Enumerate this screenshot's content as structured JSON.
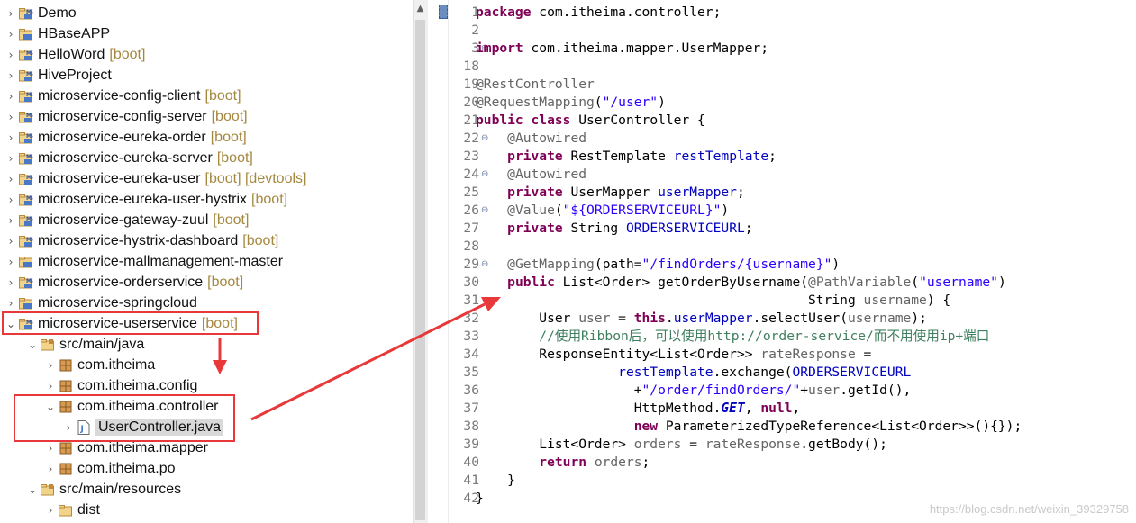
{
  "explorer": {
    "items": [
      {
        "twisty": "›",
        "icon": "maven-project-icon",
        "label": "Demo",
        "decoration": ""
      },
      {
        "twisty": "›",
        "icon": "project-folder-icon",
        "label": "HBaseAPP",
        "decoration": ""
      },
      {
        "twisty": "›",
        "icon": "maven-project-icon",
        "label": "HelloWord",
        "decoration": "[boot]"
      },
      {
        "twisty": "›",
        "icon": "maven-project-icon",
        "label": "HiveProject",
        "decoration": ""
      },
      {
        "twisty": "›",
        "icon": "maven-project-icon",
        "label": "microservice-config-client",
        "decoration": "[boot]"
      },
      {
        "twisty": "›",
        "icon": "maven-project-icon",
        "label": "microservice-config-server",
        "decoration": "[boot]"
      },
      {
        "twisty": "›",
        "icon": "maven-project-icon",
        "label": "microservice-eureka-order",
        "decoration": "[boot]"
      },
      {
        "twisty": "›",
        "icon": "maven-project-icon",
        "label": "microservice-eureka-server",
        "decoration": "[boot]"
      },
      {
        "twisty": "›",
        "icon": "maven-project-icon",
        "label": "microservice-eureka-user",
        "decoration": "[boot] [devtools]"
      },
      {
        "twisty": "›",
        "icon": "maven-project-icon",
        "label": "microservice-eureka-user-hystrix",
        "decoration": "[boot]"
      },
      {
        "twisty": "›",
        "icon": "maven-project-icon",
        "label": "microservice-gateway-zuul",
        "decoration": "[boot]"
      },
      {
        "twisty": "›",
        "icon": "maven-project-icon",
        "label": "microservice-hystrix-dashboard",
        "decoration": "[boot]"
      },
      {
        "twisty": "›",
        "icon": "project-folder-icon",
        "label": "microservice-mallmanagement-master",
        "decoration": ""
      },
      {
        "twisty": "›",
        "icon": "maven-project-icon",
        "label": "microservice-orderservice",
        "decoration": "[boot]"
      },
      {
        "twisty": "›",
        "icon": "project-folder-icon",
        "label": "microservice-springcloud",
        "decoration": ""
      },
      {
        "twisty": "⌄",
        "icon": "maven-project-icon",
        "label": "microservice-userservice",
        "decoration": "[boot]"
      },
      {
        "twisty": "⌄",
        "icon": "source-folder-icon",
        "label": "src/main/java",
        "decoration": ""
      },
      {
        "twisty": "›",
        "icon": "package-icon",
        "label": "com.itheima",
        "decoration": ""
      },
      {
        "twisty": "›",
        "icon": "package-icon",
        "label": "com.itheima.config",
        "decoration": ""
      },
      {
        "twisty": "⌄",
        "icon": "package-icon",
        "label": "com.itheima.controller",
        "decoration": ""
      },
      {
        "twisty": "›",
        "icon": "java-file-icon",
        "label": "UserController.java",
        "decoration": ""
      },
      {
        "twisty": "›",
        "icon": "package-icon",
        "label": "com.itheima.mapper",
        "decoration": ""
      },
      {
        "twisty": "›",
        "icon": "package-icon",
        "label": "com.itheima.po",
        "decoration": ""
      },
      {
        "twisty": "⌄",
        "icon": "source-folder-icon",
        "label": "src/main/resources",
        "decoration": ""
      },
      {
        "twisty": "›",
        "icon": "folder-icon",
        "label": "dist",
        "decoration": ""
      }
    ]
  },
  "editor": {
    "lines": [
      {
        "n": "1",
        "fold": "",
        "tokens": [
          [
            "kw",
            "package"
          ],
          [
            "tx",
            " com.itheima.controller;"
          ]
        ]
      },
      {
        "n": "2",
        "fold": "",
        "tokens": []
      },
      {
        "n": "3",
        "fold": "⊕",
        "tokens": [
          [
            "kw",
            "import"
          ],
          [
            "tx",
            " com.itheima.mapper.UserMapper;"
          ]
        ]
      },
      {
        "n": "18",
        "fold": "",
        "tokens": []
      },
      {
        "n": "19",
        "fold": "",
        "tokens": [
          [
            "an",
            "@RestController"
          ]
        ]
      },
      {
        "n": "20",
        "fold": "",
        "tokens": [
          [
            "an",
            "@RequestMapping"
          ],
          [
            "tx",
            "("
          ],
          [
            "str",
            "\"/user\""
          ],
          [
            "tx",
            ")"
          ]
        ]
      },
      {
        "n": "21",
        "fold": "",
        "tokens": [
          [
            "kw",
            "public"
          ],
          [
            "tx",
            " "
          ],
          [
            "kw",
            "class"
          ],
          [
            "tx",
            " UserController {"
          ]
        ]
      },
      {
        "n": "22",
        "fold": "⊖",
        "tokens": [
          [
            "tx",
            "    "
          ],
          [
            "an",
            "@Autowired"
          ]
        ]
      },
      {
        "n": "23",
        "fold": "",
        "tokens": [
          [
            "tx",
            "    "
          ],
          [
            "kw",
            "private"
          ],
          [
            "tx",
            " RestTemplate "
          ],
          [
            "fld",
            "restTemplate"
          ],
          [
            "tx",
            ";"
          ]
        ]
      },
      {
        "n": "24",
        "fold": "⊖",
        "tokens": [
          [
            "tx",
            "    "
          ],
          [
            "an",
            "@Autowired"
          ]
        ]
      },
      {
        "n": "25",
        "fold": "",
        "tokens": [
          [
            "tx",
            "    "
          ],
          [
            "kw",
            "private"
          ],
          [
            "tx",
            " UserMapper "
          ],
          [
            "fld",
            "userMapper"
          ],
          [
            "tx",
            ";"
          ]
        ]
      },
      {
        "n": "26",
        "fold": "⊖",
        "tokens": [
          [
            "tx",
            "    "
          ],
          [
            "an",
            "@Value"
          ],
          [
            "tx",
            "("
          ],
          [
            "str",
            "\"${ORDERSERVICEURL}\""
          ],
          [
            "tx",
            ")"
          ]
        ]
      },
      {
        "n": "27",
        "fold": "",
        "tokens": [
          [
            "tx",
            "    "
          ],
          [
            "kw",
            "private"
          ],
          [
            "tx",
            " String "
          ],
          [
            "fld",
            "ORDERSERVICEURL"
          ],
          [
            "tx",
            ";"
          ]
        ]
      },
      {
        "n": "28",
        "fold": "",
        "tokens": []
      },
      {
        "n": "29",
        "fold": "⊖",
        "tokens": [
          [
            "tx",
            "    "
          ],
          [
            "an",
            "@GetMapping"
          ],
          [
            "tx",
            "(path="
          ],
          [
            "str",
            "\"/findOrders/{username}\""
          ],
          [
            "tx",
            ")"
          ]
        ]
      },
      {
        "n": "30",
        "fold": "",
        "tokens": [
          [
            "tx",
            "    "
          ],
          [
            "kw",
            "public"
          ],
          [
            "tx",
            " List<Order> getOrderByUsername("
          ],
          [
            "an",
            "@PathVariable"
          ],
          [
            "tx",
            "("
          ],
          [
            "str",
            "\"username\""
          ],
          [
            "tx",
            ")"
          ]
        ]
      },
      {
        "n": "31",
        "fold": "",
        "tokens": [
          [
            "tx",
            "                                          String "
          ],
          [
            "an",
            "username"
          ],
          [
            "tx",
            ") {"
          ]
        ]
      },
      {
        "n": "32",
        "fold": "",
        "tokens": [
          [
            "tx",
            "        User "
          ],
          [
            "an",
            "user"
          ],
          [
            "tx",
            " = "
          ],
          [
            "kw",
            "this"
          ],
          [
            "tx",
            "."
          ],
          [
            "fld",
            "userMapper"
          ],
          [
            "tx",
            ".selectUser("
          ],
          [
            "an",
            "username"
          ],
          [
            "tx",
            ");"
          ]
        ]
      },
      {
        "n": "33",
        "fold": "",
        "tokens": [
          [
            "tx",
            "        "
          ],
          [
            "cm",
            "//使用Ribbon后，可以使用http://order-service/而不用使用ip+端口"
          ]
        ]
      },
      {
        "n": "34",
        "fold": "",
        "tokens": [
          [
            "tx",
            "        ResponseEntity<List<Order>> "
          ],
          [
            "an",
            "rateResponse"
          ],
          [
            "tx",
            " ="
          ]
        ]
      },
      {
        "n": "35",
        "fold": "",
        "tokens": [
          [
            "tx",
            "                  "
          ],
          [
            "fld",
            "restTemplate"
          ],
          [
            "tx",
            ".exchange("
          ],
          [
            "fld",
            "ORDERSERVICEURL"
          ]
        ]
      },
      {
        "n": "36",
        "fold": "",
        "tokens": [
          [
            "tx",
            "                    +"
          ],
          [
            "str",
            "\"/order/findOrders/\""
          ],
          [
            "tx",
            "+"
          ],
          [
            "an",
            "user"
          ],
          [
            "tx",
            ".getId(),"
          ]
        ]
      },
      {
        "n": "37",
        "fold": "",
        "tokens": [
          [
            "tx",
            "                    HttpMethod."
          ],
          [
            "bi",
            "GET"
          ],
          [
            "tx",
            ", "
          ],
          [
            "kw",
            "null"
          ],
          [
            "tx",
            ","
          ]
        ]
      },
      {
        "n": "38",
        "fold": "",
        "tokens": [
          [
            "tx",
            "                    "
          ],
          [
            "kw",
            "new"
          ],
          [
            "tx",
            " ParameterizedTypeReference<List<Order>>(){});"
          ]
        ]
      },
      {
        "n": "39",
        "fold": "",
        "tokens": [
          [
            "tx",
            "        List<Order> "
          ],
          [
            "an",
            "orders"
          ],
          [
            "tx",
            " = "
          ],
          [
            "an",
            "rateResponse"
          ],
          [
            "tx",
            ".getBody();"
          ]
        ]
      },
      {
        "n": "40",
        "fold": "",
        "tokens": [
          [
            "tx",
            "        "
          ],
          [
            "kw",
            "return"
          ],
          [
            "tx",
            " "
          ],
          [
            "an",
            "orders"
          ],
          [
            "tx",
            ";"
          ]
        ]
      },
      {
        "n": "41",
        "fold": "",
        "tokens": [
          [
            "tx",
            "    }"
          ]
        ]
      },
      {
        "n": "42",
        "fold": "",
        "tokens": [
          [
            "tx",
            "}"
          ]
        ]
      }
    ]
  },
  "watermark": "https://blog.csdn.net/weixin_39329758",
  "colors": {
    "annotation_red": "#e8383a",
    "keyword": "#7f0055",
    "string": "#2a00ff",
    "field": "#0000c0",
    "comment": "#3f7f5f",
    "decoration": "#a5883f"
  }
}
